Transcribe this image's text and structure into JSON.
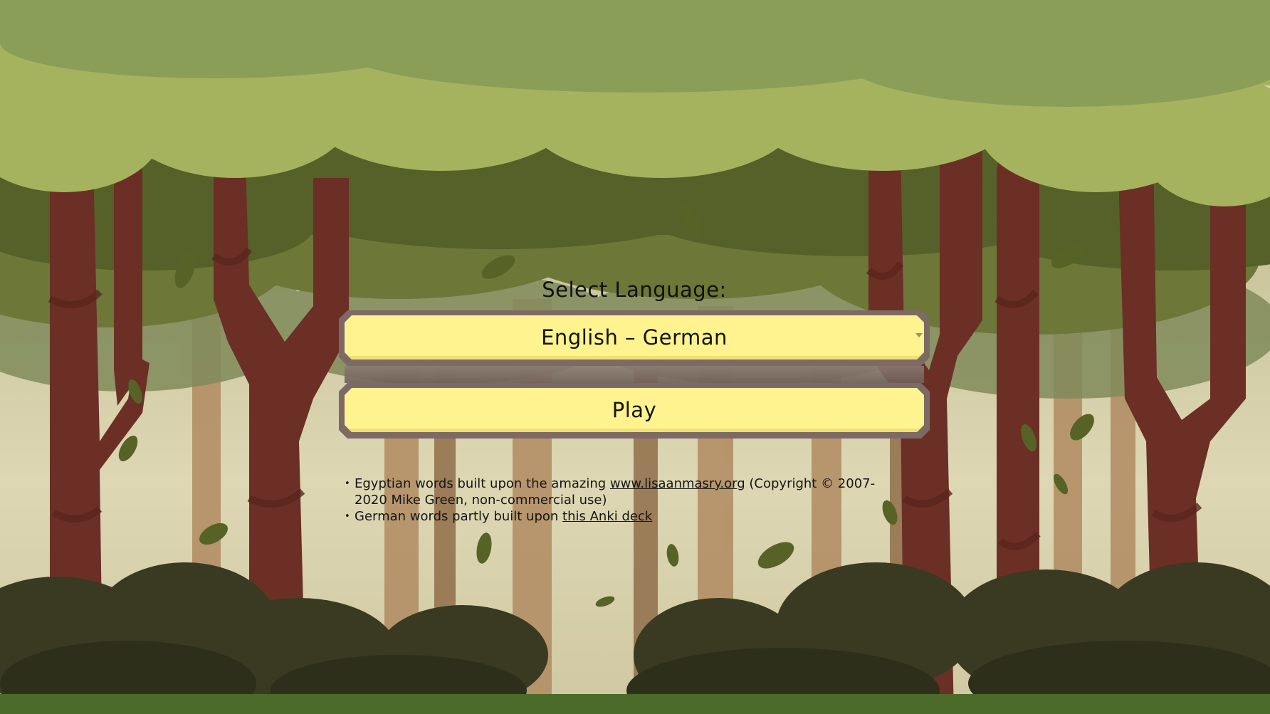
{
  "colors": {
    "sky_canopy": "#8a9e57",
    "canopy_light": "#a5b35f",
    "canopy_dark": "#576326",
    "trunk": "#6b2f26",
    "far_trunk": "#a87d53",
    "mist": "#d9d3ae",
    "bush_dark": "#3a3a22",
    "ground": "#4b6b2a",
    "button_fill": "#fff38f",
    "button_frame": "#7d6a64"
  },
  "menu": {
    "select_label": "Select Language:",
    "language_select_value": "English – German",
    "play_label": "Play"
  },
  "credits": {
    "line1_prefix": "Egyptian words built upon the amazing ",
    "line1_link": "www.lisaanmasry.org",
    "line1_suffix": " (Copyright © 2007-2020 Mike Green, non-commercial use)",
    "line2_prefix": "German words partly built upon ",
    "line2_link": "this Anki deck"
  }
}
